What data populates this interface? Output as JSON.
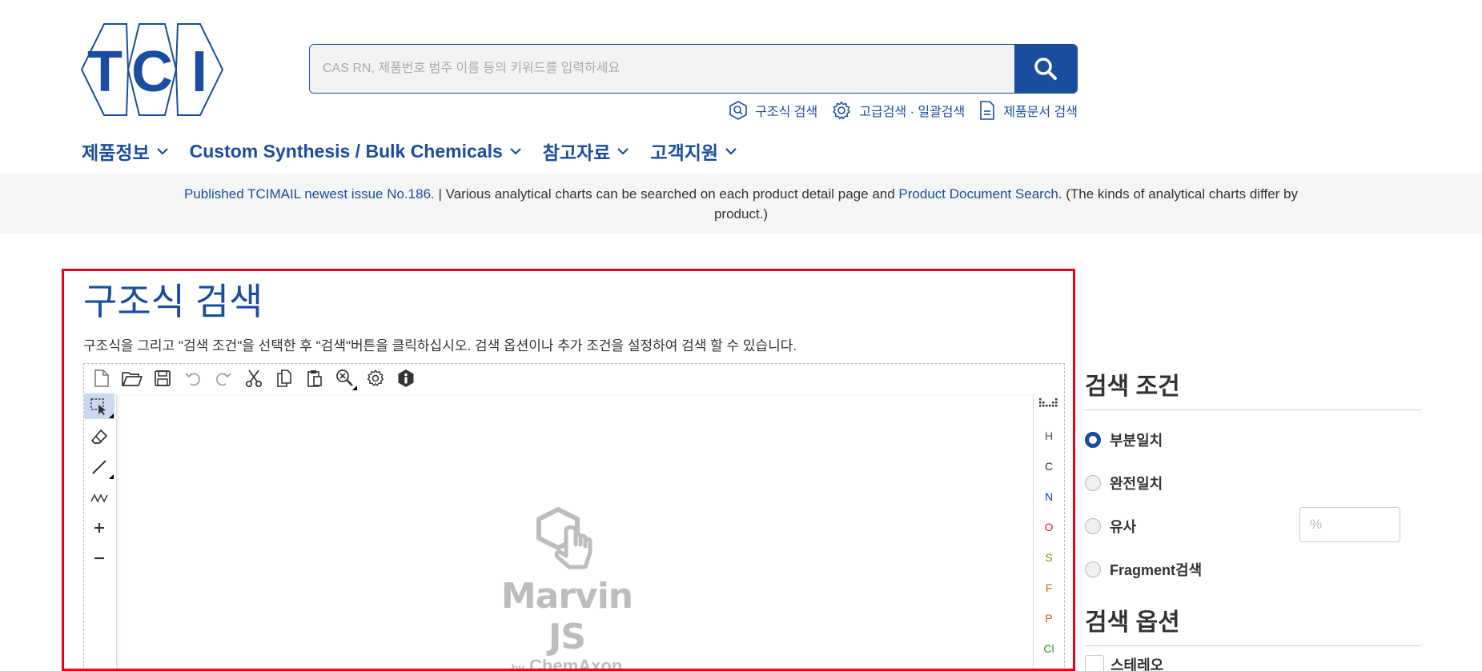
{
  "header": {
    "logo_letters": [
      "T",
      "C",
      "I"
    ],
    "search_placeholder": "CAS RN, 제품번호 범주 이름 등의 키워드를 입력하세요",
    "search_icon": "search-icon",
    "sublinks": [
      {
        "label": "구조식 검색",
        "icon": "structure-search-icon"
      },
      {
        "label": "고급검색 · 일괄검색",
        "icon": "gear-icon"
      },
      {
        "label": "제품문서 검색",
        "icon": "document-icon"
      }
    ],
    "nav": [
      {
        "label": "제품정보"
      },
      {
        "label": "Custom Synthesis / Bulk Chemicals"
      },
      {
        "label": "참고자료"
      },
      {
        "label": "고객지원"
      }
    ],
    "brand_color": "#1a4d9e"
  },
  "notice": {
    "link1": "Published TCIMAIL newest issue No.186.",
    "text1": " | Various analytical charts can be searched on each product detail page and ",
    "link2": "Product Document Search",
    "text2": ". (The kinds of analytical charts differ by product.)"
  },
  "main": {
    "title": "구조식 검색",
    "instruction": "구조식을 그리고 \"검색 조건\"을 선택한 후 \"검색\"버튼을 클릭하십시오. 검색 옵션이나 추가 조건을 설정하여 검색 할 수 있습니다.",
    "highlight_color": "#e8001c",
    "editor": {
      "top_tools": [
        "new-file-icon",
        "open-folder-icon",
        "save-icon",
        "undo-icon",
        "redo-icon",
        "cut-icon",
        "copy-icon",
        "paste-icon",
        "zoom-clear-icon",
        "settings-icon",
        "info-icon"
      ],
      "left_tools": [
        "rectangle-select-icon",
        "eraser-icon",
        "single-bond-icon",
        "chain-icon",
        "charge-plus-icon",
        "charge-minus-icon"
      ],
      "logo_name": "Marvin JS",
      "logo_by": "by",
      "logo_company": "ChemAxon",
      "elements": [
        {
          "symbol": "H",
          "color": "#555555"
        },
        {
          "symbol": "C",
          "color": "#333333"
        },
        {
          "symbol": "N",
          "color": "#1a3fd0"
        },
        {
          "symbol": "O",
          "color": "#e02020"
        },
        {
          "symbol": "S",
          "color": "#8a8a00"
        },
        {
          "symbol": "F",
          "color": "#c07000"
        },
        {
          "symbol": "P",
          "color": "#d06000"
        },
        {
          "symbol": "Cl",
          "color": "#1a9a1a"
        }
      ]
    }
  },
  "side": {
    "conditions_title": "검색 조건",
    "options": [
      {
        "label": "부분일치",
        "checked": true
      },
      {
        "label": "완전일치",
        "checked": false
      },
      {
        "label": "유사",
        "checked": false
      },
      {
        "label": "Fragment검색",
        "checked": false
      }
    ],
    "similarity_placeholder": "%",
    "options_title": "검색 옵션",
    "stereo_label": "스테레오"
  }
}
